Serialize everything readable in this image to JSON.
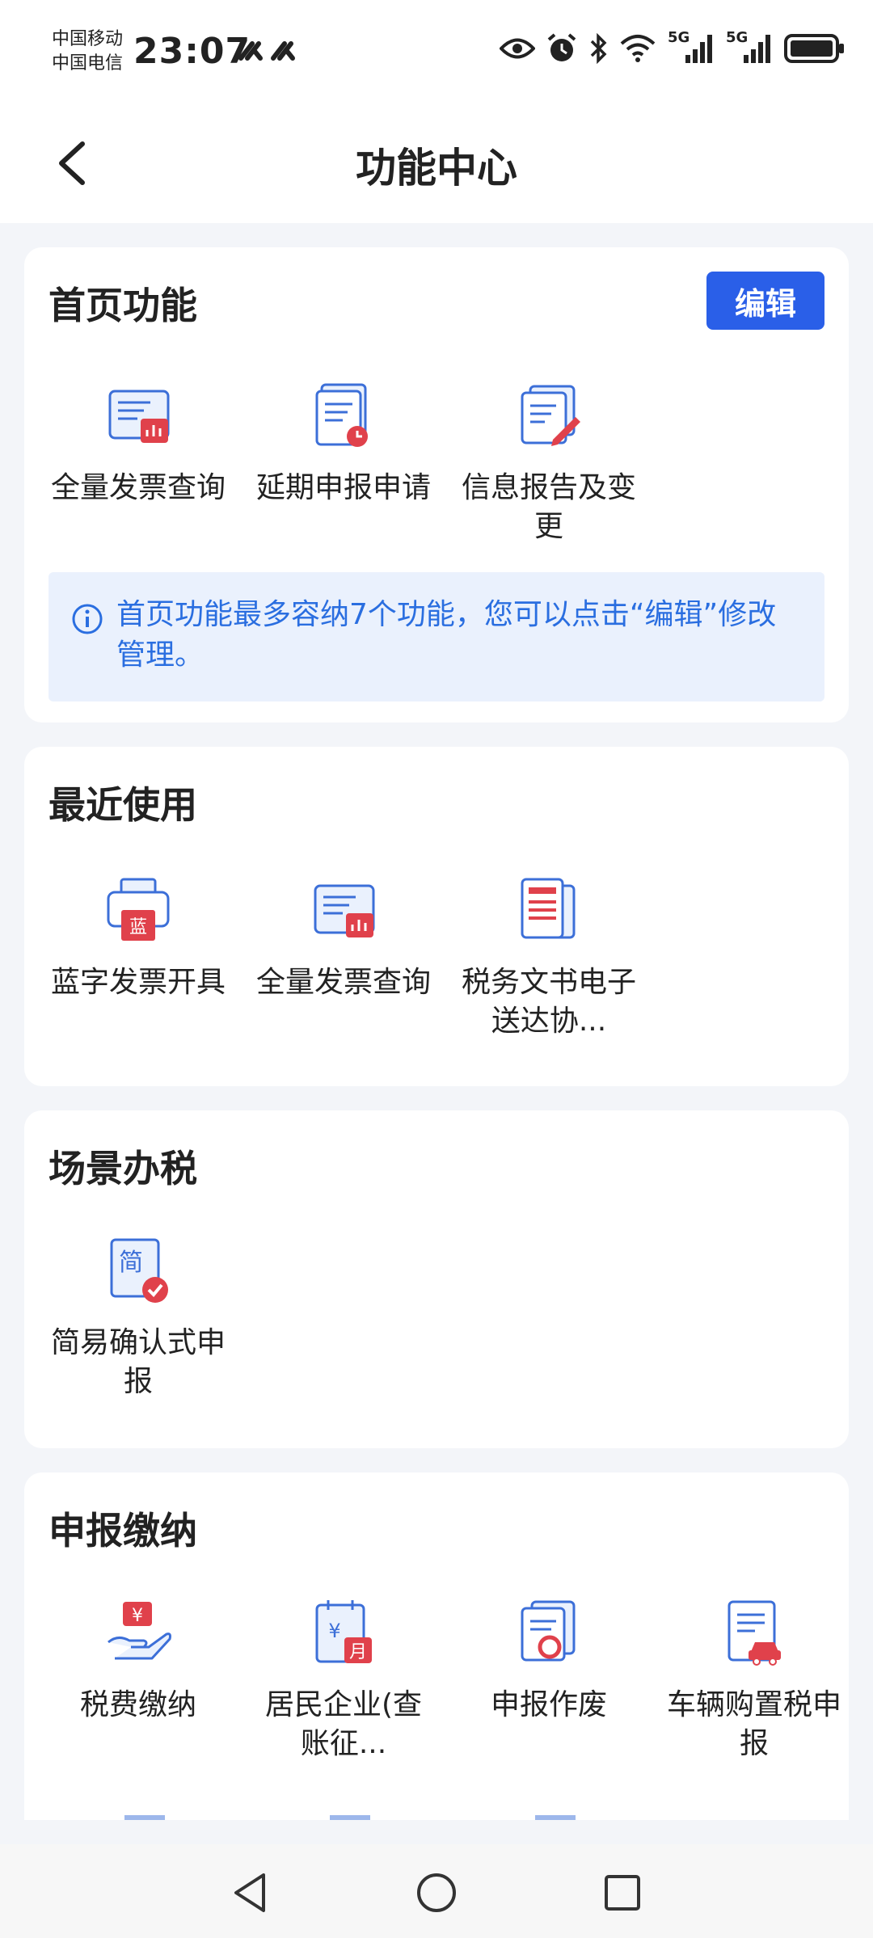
{
  "status_bar": {
    "carrier_1": "中国移动",
    "carrier_2": "中国电信",
    "time": "23:07",
    "network_1": "5G",
    "network_2": "5G",
    "icons": [
      "eye-icon",
      "alarm-icon",
      "bluetooth-icon",
      "wifi-icon",
      "signal-icon",
      "signal-icon",
      "battery-icon"
    ]
  },
  "header": {
    "title": "功能中心"
  },
  "home_functions": {
    "title": "首页功能",
    "edit_label": "编辑",
    "items": [
      {
        "label": "全量发票查询",
        "icon": "invoice-chart-icon"
      },
      {
        "label": "延期申报申请",
        "icon": "document-clock-icon"
      },
      {
        "label": "信息报告及变更",
        "icon": "document-edit-icon"
      }
    ],
    "notice": "首页功能最多容纳7个功能，您可以点击“编辑”修改管理。"
  },
  "recent": {
    "title": "最近使用",
    "items": [
      {
        "label": "蓝字发票开具",
        "icon": "printer-blue-icon",
        "glyph": "蓝"
      },
      {
        "label": "全量发票查询",
        "icon": "invoice-chart-icon"
      },
      {
        "label": "税务文书电子送达协...",
        "icon": "document-list-icon"
      }
    ]
  },
  "scene": {
    "title": "场景办税",
    "items": [
      {
        "label": "简易确认式申报",
        "icon": "simple-check-icon",
        "glyph": "简"
      }
    ]
  },
  "declare_pay": {
    "title": "申报缴纳",
    "items": [
      {
        "label": "税费缴纳",
        "icon": "hand-yuan-icon",
        "glyph": "¥"
      },
      {
        "label": "居民企业(查账征...",
        "icon": "calendar-month-icon",
        "glyph": "月"
      },
      {
        "label": "申报作废",
        "icon": "document-refresh-icon"
      },
      {
        "label": "车辆购置税申报",
        "icon": "document-car-icon"
      }
    ]
  },
  "colors": {
    "accent": "#2a5fe8",
    "icon_blue": "#3c6fd8",
    "icon_red": "#e0414b",
    "notice_bg": "#eaf1fd",
    "notice_text": "#2a6ee0"
  }
}
